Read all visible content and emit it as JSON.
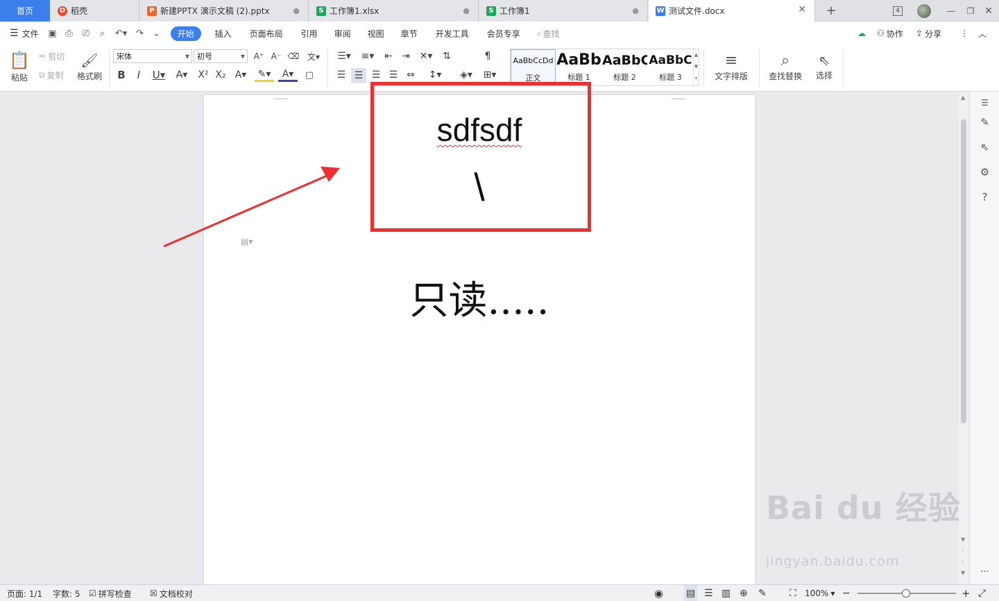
{
  "tabs": [
    {
      "label": "首页"
    },
    {
      "label": "稻壳"
    },
    {
      "label": "新建PPTX 演示文稿 (2).pptx"
    },
    {
      "label": "工作簿1.xlsx"
    },
    {
      "label": "工作簿1"
    },
    {
      "label": "测试文件.docx"
    }
  ],
  "tabbar": {
    "new_tab": "+",
    "window_count": "4"
  },
  "menu": {
    "file": "文件",
    "items": [
      "开始",
      "插入",
      "页面布局",
      "引用",
      "审阅",
      "视图",
      "章节",
      "开发工具",
      "会员专享"
    ],
    "search": "查找",
    "collab": "协作",
    "share": "分享"
  },
  "ribbon": {
    "paste": "粘贴",
    "cut": "剪切",
    "copy": "复制",
    "format_painter": "格式刷",
    "font_name": "宋体",
    "font_size": "初号",
    "styles": [
      {
        "preview": "AaBbCcDd",
        "name": "正文"
      },
      {
        "preview": "AaBb",
        "name": "标题 1"
      },
      {
        "preview": "AaBbC",
        "name": "标题 2"
      },
      {
        "preview": "AaBbC",
        "name": "标题 3"
      }
    ],
    "text_layout": "文字排版",
    "find_replace": "查找替换",
    "select": "选择"
  },
  "document": {
    "line1": "sdfsdf",
    "line2": "\\",
    "line3": "只读....."
  },
  "status": {
    "page": "页面: 1/1",
    "words": "字数: 5",
    "spell_check": "拼写检查",
    "doc_proof": "文档校对",
    "zoom": "100%"
  },
  "colors": {
    "accent": "#3c7eeb",
    "annotation_red": "#ef2f2f"
  },
  "watermark": {
    "brand": "Bai du 经验",
    "url": "jingyan.baidu.com"
  }
}
